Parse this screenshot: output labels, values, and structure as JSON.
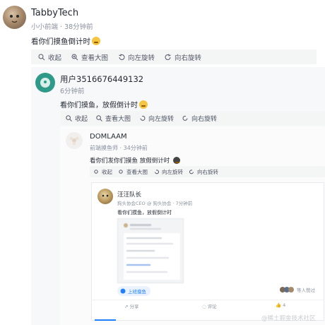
{
  "post": {
    "author": "TabbyTech",
    "role": "小小前端",
    "time": "38分钟前",
    "content": "看你们摸鱼倒计时"
  },
  "toolbar": {
    "collapse": "收起",
    "view_large": "查看大图",
    "rotate_left": "向左旋转",
    "rotate_right": "向右旋转"
  },
  "quote1": {
    "author": "用户3516676449132",
    "time": "6分钟前",
    "content": "看你们摸鱼，放假倒计时"
  },
  "quote2": {
    "author": "DOMLAAM",
    "role": "前端摸鱼师",
    "time": "34分钟前",
    "content": "看你们发你们摸鱼 放假倒计时"
  },
  "quote3": {
    "author": "汪汪队长",
    "role": "狗头协会CEO @ 狗头协会",
    "time": "7分钟前",
    "content": "看你们摸鱼，放假倒计时",
    "tag": "上班摸鱼",
    "likes_text": "等人赞过",
    "share": "分享",
    "comment": "评论",
    "like_count": "4"
  },
  "watermark": "@稀土掘金技术社区",
  "colors": {
    "accent": "#1e80ff",
    "panel": "#f7f8fa",
    "toolbar": "#f4f5f5"
  }
}
